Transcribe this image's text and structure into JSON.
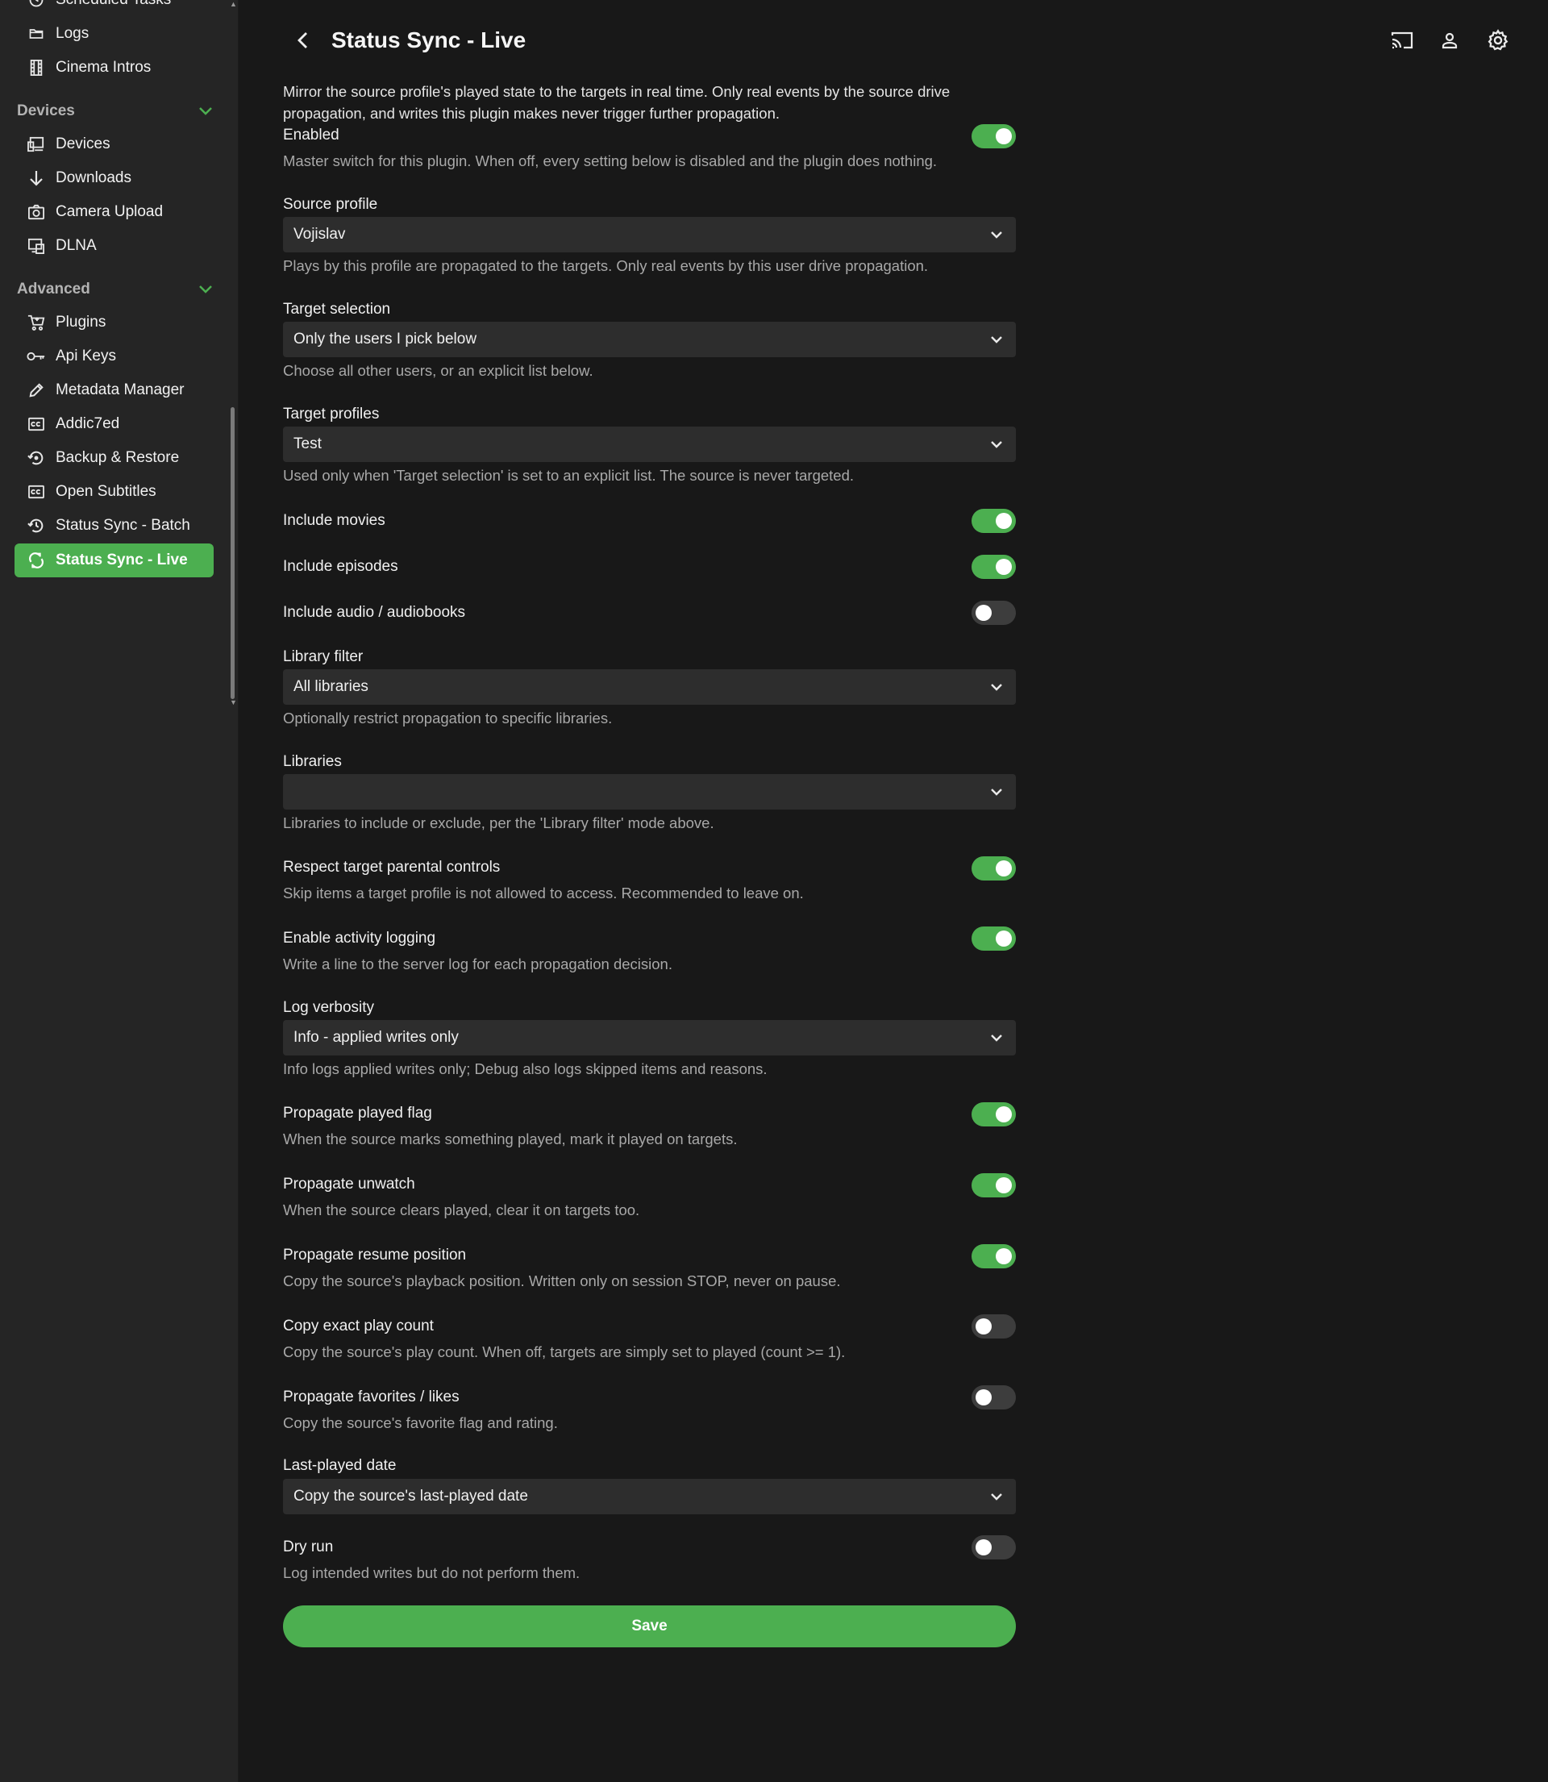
{
  "sidebar": {
    "top_items": [
      {
        "label": "Scheduled Tasks",
        "icon": "clock-icon"
      },
      {
        "label": "Logs",
        "icon": "folder-icon"
      },
      {
        "label": "Cinema Intros",
        "icon": "film-icon"
      }
    ],
    "devices_header": "Devices",
    "devices_items": [
      {
        "label": "Devices",
        "icon": "devices-icon"
      },
      {
        "label": "Downloads",
        "icon": "download-icon"
      },
      {
        "label": "Camera Upload",
        "icon": "camera-icon"
      },
      {
        "label": "DLNA",
        "icon": "dlna-icon"
      }
    ],
    "advanced_header": "Advanced",
    "advanced_items": [
      {
        "label": "Plugins",
        "icon": "cart-icon"
      },
      {
        "label": "Api Keys",
        "icon": "key-icon"
      },
      {
        "label": "Metadata Manager",
        "icon": "pencil-icon"
      },
      {
        "label": "Addic7ed",
        "icon": "subtitles-icon"
      },
      {
        "label": "Backup & Restore",
        "icon": "restore-icon"
      },
      {
        "label": "Open Subtitles",
        "icon": "subtitles-icon"
      },
      {
        "label": "Status Sync - Batch",
        "icon": "history-icon"
      },
      {
        "label": "Status Sync - Live",
        "icon": "sync-icon",
        "active": true
      }
    ]
  },
  "header": {
    "title": "Status Sync - Live"
  },
  "intro": "Mirror the source profile's played state to the targets in real time. Only real events by the source drive propagation, and writes this plugin makes never trigger further propagation.",
  "settings": {
    "enabled": {
      "label": "Enabled",
      "desc": "Master switch for this plugin. When off, every setting below is disabled and the plugin does nothing.",
      "on": true
    },
    "source_profile": {
      "label": "Source profile",
      "value": "Vojislav",
      "desc": "Plays by this profile are propagated to the targets. Only real events by this user drive propagation."
    },
    "target_selection": {
      "label": "Target selection",
      "value": "Only the users I pick below",
      "desc": "Choose all other users, or an explicit list below."
    },
    "target_profiles": {
      "label": "Target profiles",
      "value": "Test",
      "desc": "Used only when 'Target selection' is set to an explicit list. The source is never targeted."
    },
    "include_movies": {
      "label": "Include movies",
      "on": true
    },
    "include_episodes": {
      "label": "Include episodes",
      "on": true
    },
    "include_audio": {
      "label": "Include audio / audiobooks",
      "on": false
    },
    "library_filter": {
      "label": "Library filter",
      "value": "All libraries",
      "desc": "Optionally restrict propagation to specific libraries."
    },
    "libraries": {
      "label": "Libraries",
      "value": "",
      "desc": "Libraries to include or exclude, per the 'Library filter' mode above."
    },
    "parental": {
      "label": "Respect target parental controls",
      "desc": "Skip items a target profile is not allowed to access. Recommended to leave on.",
      "on": true
    },
    "activity_logging": {
      "label": "Enable activity logging",
      "desc": "Write a line to the server log for each propagation decision.",
      "on": true
    },
    "log_verbosity": {
      "label": "Log verbosity",
      "value": "Info - applied writes only",
      "desc": "Info logs applied writes only; Debug also logs skipped items and reasons."
    },
    "played_flag": {
      "label": "Propagate played flag",
      "desc": "When the source marks something played, mark it played on targets.",
      "on": true
    },
    "unwatch": {
      "label": "Propagate unwatch",
      "desc": "When the source clears played, clear it on targets too.",
      "on": true
    },
    "resume_position": {
      "label": "Propagate resume position",
      "desc": "Copy the source's playback position. Written only on session STOP, never on pause.",
      "on": true
    },
    "play_count": {
      "label": "Copy exact play count",
      "desc": "Copy the source's play count. When off, targets are simply set to played (count >= 1).",
      "on": false
    },
    "favorites": {
      "label": "Propagate favorites / likes",
      "desc": "Copy the source's favorite flag and rating.",
      "on": false
    },
    "last_played": {
      "label": "Last-played date",
      "value": "Copy the source's last-played date"
    },
    "dry_run": {
      "label": "Dry run",
      "desc": "Log intended writes but do not perform them.",
      "on": false
    }
  },
  "save_label": "Save",
  "colors": {
    "accent": "#4caf50",
    "background": "#181818",
    "sidebar": "#252525",
    "field": "#2d2d2d"
  }
}
